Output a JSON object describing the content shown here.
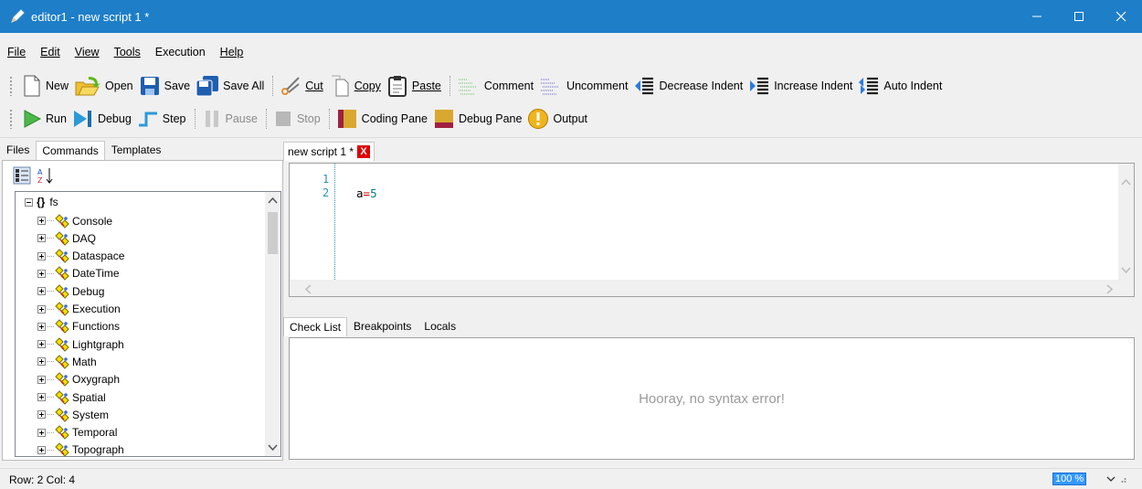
{
  "window": {
    "title": "editor1 - new script 1 *"
  },
  "menu": [
    "File",
    "Edit",
    "View",
    "Tools",
    "Execution",
    "Help"
  ],
  "toolbar1": {
    "new": "New",
    "open": "Open",
    "save": "Save",
    "save_all": "Save All",
    "cut": "Cut",
    "copy": "Copy",
    "paste": "Paste",
    "comment": "Comment",
    "uncomment": "Uncomment",
    "decrease_indent": "Decrease Indent",
    "increase_indent": "Increase Indent",
    "auto_indent": "Auto Indent"
  },
  "toolbar2": {
    "run": "Run",
    "debug": "Debug",
    "step": "Step",
    "pause": "Pause",
    "stop": "Stop",
    "coding_pane": "Coding Pane",
    "debug_pane": "Debug Pane",
    "output": "Output"
  },
  "left_tabs": [
    "Files",
    "Commands",
    "Templates"
  ],
  "left_active_tab": "Commands",
  "tree": {
    "root": "fs",
    "items": [
      "Console",
      "DAQ",
      "Dataspace",
      "DateTime",
      "Debug",
      "Execution",
      "Functions",
      "Lightgraph",
      "Math",
      "Oxygraph",
      "Spatial",
      "System",
      "Temporal",
      "Topograph"
    ]
  },
  "editor": {
    "tab_title": "new script 1 *",
    "close_glyph": "X",
    "line_numbers": [
      "1",
      "2"
    ],
    "code": {
      "var": "a",
      "op": "=",
      "num": "5"
    }
  },
  "bottom_tabs": [
    "Check List",
    "Breakpoints",
    "Locals"
  ],
  "bottom_active_tab": "Check List",
  "checklist_message": "Hooray, no syntax error!",
  "status": {
    "position": "Row: 2  Col: 4",
    "zoom": "100 %"
  },
  "colors": {
    "titlebar": "#1e7ec8",
    "close_tab": "#e00000",
    "line_number": "#2b91af",
    "operator": "#d00000",
    "number": "#008080",
    "zoom_highlight": "#3399ff"
  }
}
